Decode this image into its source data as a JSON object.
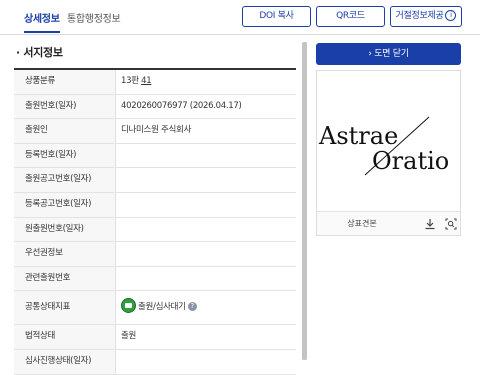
{
  "tabs": {
    "active": "상세정보",
    "inactive": "통합행정정보"
  },
  "toolbar": {
    "doi": "DOI 복사",
    "qr": "QR코드",
    "reject": "거절정보제공"
  },
  "section_title": "· 서지정보",
  "rows": [
    {
      "label": "상품분류",
      "value": "13판",
      "value_link": "41"
    },
    {
      "label": "출원번호(일자)",
      "value": "4020260076977 (2026.04.17)"
    },
    {
      "label": "출원인",
      "value": "디나미스원 주식회사"
    },
    {
      "label": "등록번호(일자)",
      "value": ""
    },
    {
      "label": "출원공고번호(일자)",
      "value": ""
    },
    {
      "label": "등록공고번호(일자)",
      "value": ""
    },
    {
      "label": "원출원번호(일자)",
      "value": ""
    },
    {
      "label": "우선권정보",
      "value": ""
    },
    {
      "label": "관련출원번호",
      "value": ""
    },
    {
      "label": "공통상태지표",
      "value": "출원/심사대기"
    },
    {
      "label": "법적상태",
      "value": "출원"
    },
    {
      "label": "심사진행상태(일자)",
      "value": ""
    }
  ],
  "right": {
    "close_button": "도면 닫기",
    "logo_line1": "Astrae",
    "logo_line2": "Oratio",
    "footer_label": "상표견본"
  },
  "icons": {
    "info": "info-icon",
    "status": "folder-status-icon",
    "help": "question-icon",
    "download": "download-icon",
    "zoom": "zoom-icon",
    "chevron": "chevron-right-icon"
  },
  "colors": {
    "accent": "#1a3fa8",
    "status_green": "#2e9e3f"
  }
}
